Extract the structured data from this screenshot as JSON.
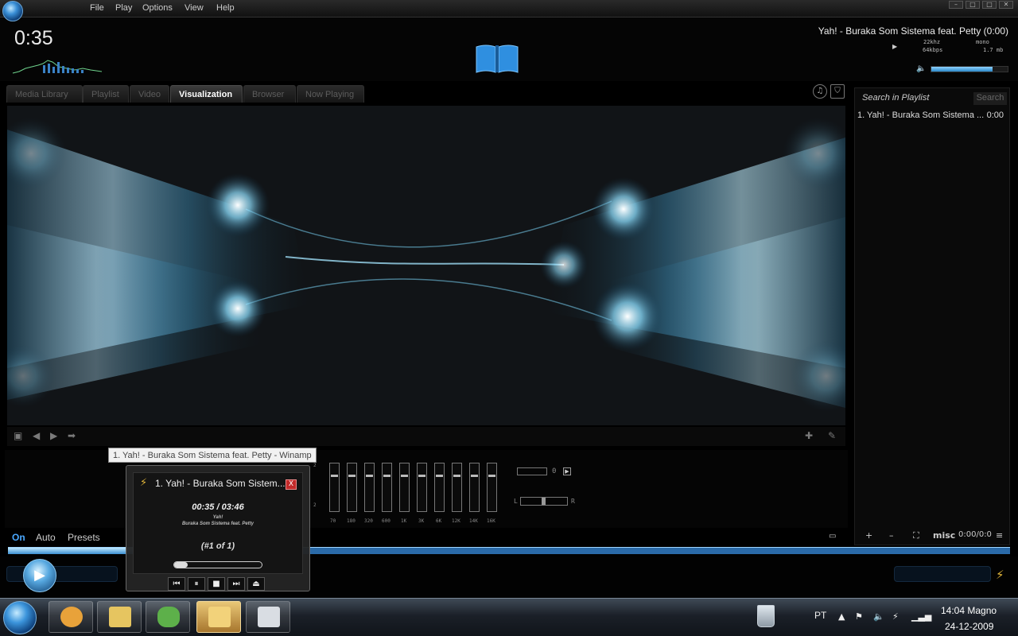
{
  "menu": {
    "items": [
      "File",
      "Play",
      "Options",
      "View",
      "Help"
    ]
  },
  "window_controls": [
    "–",
    "□",
    "□",
    "✕"
  ],
  "player": {
    "elapsed": "0:35",
    "title_display": "Yah! - Buraka Som Sistema feat. Petty (0:00)",
    "samplerate": "22khz",
    "bitrate": "64kbps",
    "channels": "mono",
    "filesize": "1.7 mb",
    "volume_level": 0.8,
    "seek_progress": 0.15
  },
  "tabs": [
    {
      "label": "Media Library",
      "active": false
    },
    {
      "label": "Playlist",
      "active": false
    },
    {
      "label": "Video",
      "active": false
    },
    {
      "label": "Visualization",
      "active": true
    },
    {
      "label": "Browser",
      "active": false
    },
    {
      "label": "Now Playing",
      "active": false
    }
  ],
  "tab_icons": [
    "music-note-icon",
    "shield-icon"
  ],
  "tooltip": "1. Yah! - Buraka Som Sistema feat. Petty - Winamp",
  "equalizer": {
    "bands": [
      {
        "label": "70",
        "level": 0.25
      },
      {
        "label": "180",
        "level": 0.25
      },
      {
        "label": "320",
        "level": 0.25
      },
      {
        "label": "600",
        "level": 0.25
      },
      {
        "label": "1K",
        "level": 0.25
      },
      {
        "label": "3K",
        "level": 0.25
      },
      {
        "label": "6K",
        "level": 0.25
      },
      {
        "label": "12K",
        "level": 0.25
      },
      {
        "label": "14K",
        "level": 0.25
      },
      {
        "label": "16K",
        "level": 0.25
      }
    ],
    "on_label": "On",
    "auto_label": "Auto",
    "presets_label": "Presets",
    "preamp_value": "0",
    "balance_left": "L",
    "balance_right": "R",
    "scale_top": "2",
    "scale_bottom": "2"
  },
  "playlist": {
    "search_label": "Search in Playlist",
    "search_button": "Search",
    "items": [
      {
        "title": "1. Yah! - Buraka Som Sistema ...",
        "duration": "0:00"
      }
    ],
    "add_label": "+",
    "remove_label": "–",
    "select_label": "⛶",
    "misc_label": "misc",
    "total_time": "0:00/0:0",
    "menu_label": "≡"
  },
  "notification": {
    "title": "1. Yah! - Buraka Som Sistem...",
    "time": "00:35 / 03:46",
    "song": "Yah!",
    "artist": "Buraka Som Sistema feat. Petty",
    "count": "(#1 of 1)",
    "progress": 0.15,
    "close_label": "X"
  },
  "taskbar": {
    "language": "PT",
    "clock_time": "14:04 Magno",
    "clock_date": "24-12-2009",
    "apps": [
      {
        "name": "internet-explorer-icon",
        "active": false,
        "color": "#e8a23a"
      },
      {
        "name": "file-explorer-icon",
        "active": false,
        "color": "#e6c560"
      },
      {
        "name": "messenger-icon",
        "active": false,
        "color": "#5db04a"
      },
      {
        "name": "winamp-icon",
        "active": true,
        "color": "#f2d27a"
      },
      {
        "name": "window-switcher-icon",
        "active": false,
        "color": "#d9dde3"
      }
    ]
  },
  "colors": {
    "accent": "#3b8ed0",
    "highlight": "#9fd6ff",
    "bolt": "#e2b63a"
  }
}
